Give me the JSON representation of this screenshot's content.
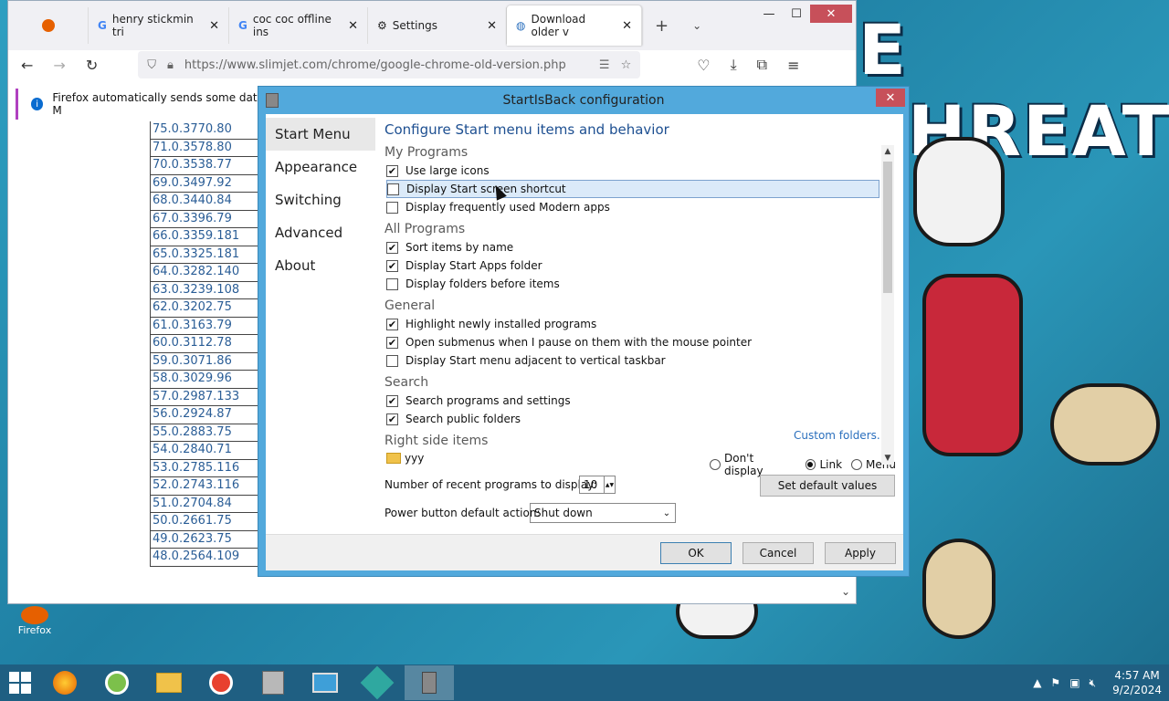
{
  "browser": {
    "tabs": [
      {
        "label": "",
        "icon": "firefox-icon"
      },
      {
        "label": "henry stickmin tri",
        "icon": "google-icon"
      },
      {
        "label": "coc coc offline ins",
        "icon": "google-icon"
      },
      {
        "label": "Settings",
        "icon": "gear-icon"
      },
      {
        "label": "Download older v",
        "icon": "globe-icon",
        "selected": true
      }
    ],
    "url": "https://www.slimjet.com/chrome/google-chrome-old-version.php",
    "infobar_text": "Firefox automatically sends some data to M",
    "versions": [
      "75.0.3770.80",
      "71.0.3578.80",
      "70.0.3538.77",
      "69.0.3497.92",
      "68.0.3440.84",
      "67.0.3396.79",
      "66.0.3359.181",
      "65.0.3325.181",
      "64.0.3282.140",
      "63.0.3239.108",
      "62.0.3202.75",
      "61.0.3163.79",
      "60.0.3112.78",
      "59.0.3071.86",
      "58.0.3029.96",
      "57.0.2987.133",
      "56.0.2924.87",
      "55.0.2883.75",
      "54.0.2840.71",
      "53.0.2785.116",
      "52.0.2743.116",
      "51.0.2704.84",
      "50.0.2661.75",
      "49.0.2623.75",
      "48.0.2564.109"
    ]
  },
  "dialog": {
    "title": "StartIsBack configuration",
    "sidebar": [
      "Start Menu",
      "Appearance",
      "Switching",
      "Advanced",
      "About"
    ],
    "heading": "Configure Start menu items and behavior",
    "sections": {
      "my_programs": "My Programs",
      "all_programs": "All Programs",
      "general": "General",
      "search": "Search",
      "right_side": "Right side items"
    },
    "options": {
      "large_icons": {
        "label": "Use large icons",
        "checked": true
      },
      "start_screen": {
        "label": "Display Start screen shortcut",
        "checked": false
      },
      "modern_apps": {
        "label": "Display frequently used Modern apps",
        "checked": false
      },
      "sort_name": {
        "label": "Sort items by name",
        "checked": true
      },
      "apps_folder": {
        "label": "Display Start Apps folder",
        "checked": true
      },
      "folders_before": {
        "label": "Display folders before items",
        "checked": false
      },
      "highlight_new": {
        "label": "Highlight newly installed programs",
        "checked": true
      },
      "open_submenus": {
        "label": "Open submenus when I pause on them with the mouse pointer",
        "checked": true
      },
      "adjacent_taskbar": {
        "label": "Display Start menu adjacent to vertical taskbar",
        "checked": false
      },
      "search_programs": {
        "label": "Search programs and settings",
        "checked": true
      },
      "search_public": {
        "label": "Search public folders",
        "checked": true
      }
    },
    "custom_folders": "Custom folders...",
    "right_item": {
      "name": "yyy",
      "choices": [
        "Don't display",
        "Link",
        "Menu"
      ],
      "selected": "Link"
    },
    "recent_label": "Number of recent programs to display:",
    "recent_value": "10",
    "set_default": "Set default values",
    "power_label": "Power button default action:",
    "power_value": "Shut down",
    "buttons": {
      "ok": "OK",
      "cancel": "Cancel",
      "apply": "Apply"
    }
  },
  "desktop": {
    "banner": "E THREAT",
    "icon_label": "Firefox"
  },
  "taskbar": {
    "time": "4:57 AM",
    "date": "9/2/2024"
  }
}
